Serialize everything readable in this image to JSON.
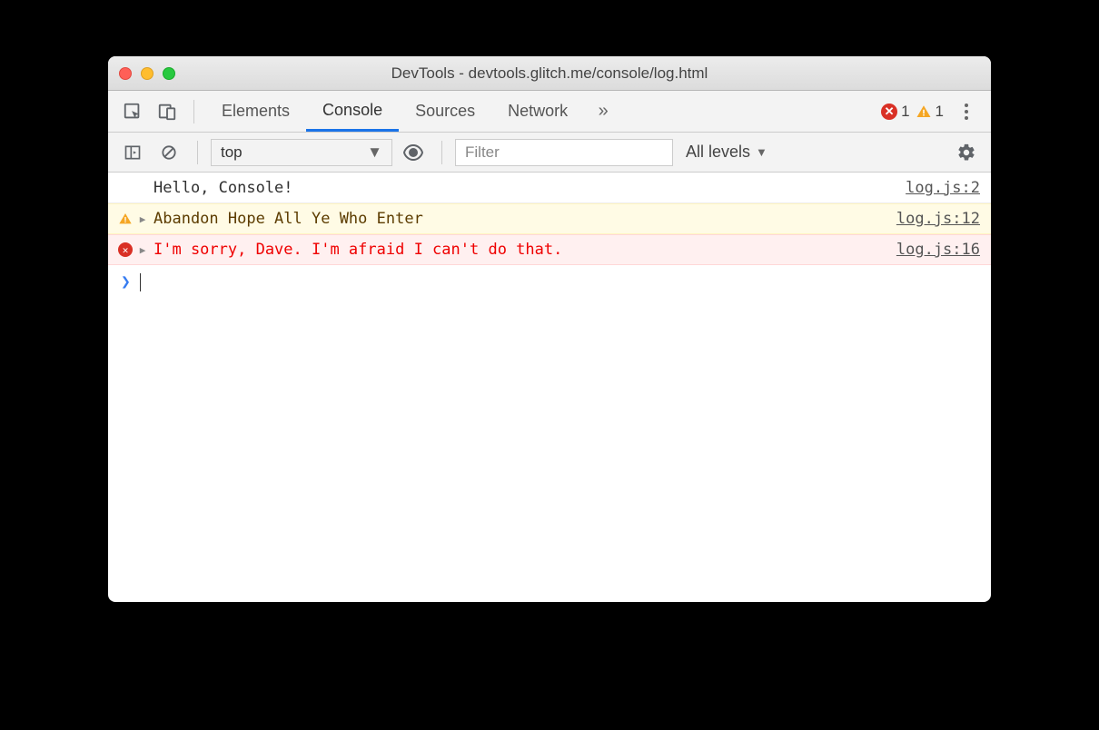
{
  "window": {
    "title": "DevTools - devtools.glitch.me/console/log.html"
  },
  "tabs": {
    "elements": "Elements",
    "console": "Console",
    "sources": "Sources",
    "network": "Network"
  },
  "badges": {
    "error_count": "1",
    "warning_count": "1"
  },
  "subbar": {
    "context": "top",
    "filter_placeholder": "Filter",
    "levels_label": "All levels"
  },
  "logs": [
    {
      "type": "log",
      "message": "Hello, Console!",
      "source": "log.js:2"
    },
    {
      "type": "warn",
      "message": "Abandon Hope All Ye Who Enter",
      "source": "log.js:12"
    },
    {
      "type": "error",
      "message": "I'm sorry, Dave. I'm afraid I can't do that.",
      "source": "log.js:16"
    }
  ]
}
